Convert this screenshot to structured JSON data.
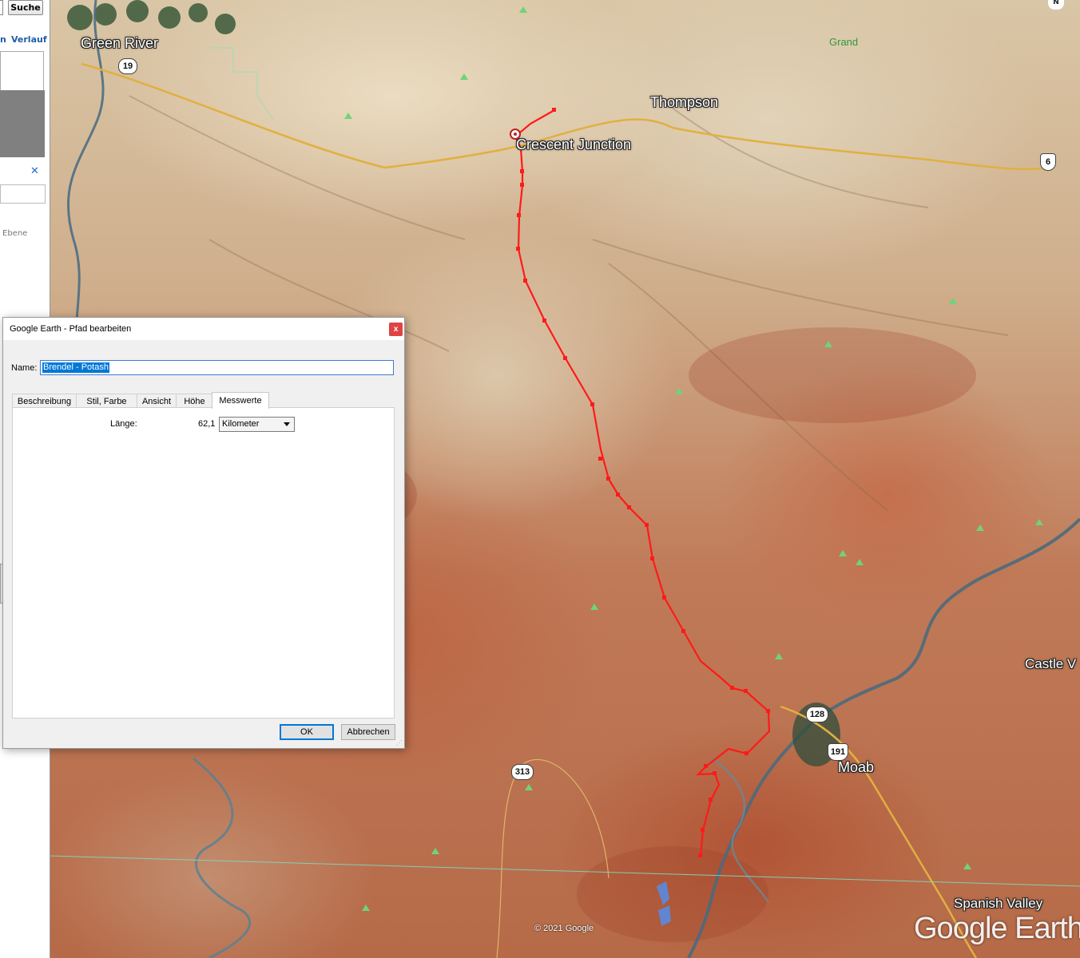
{
  "sidebar": {
    "search_button": "Suche",
    "tab_fragment": "n",
    "history_tab": "Verlauf",
    "close_glyph": "✕",
    "layer_label": "Ebene"
  },
  "map": {
    "places": [
      {
        "label": "Green River"
      },
      {
        "label": "Thompson"
      },
      {
        "label": "Crescent Junction"
      },
      {
        "label": "Grand"
      },
      {
        "label": "Moab"
      },
      {
        "label": "Castle V"
      },
      {
        "label": "Spanish Valley"
      }
    ],
    "road_shields": [
      "19",
      "6",
      "128",
      "191",
      "313"
    ],
    "north_indicator": "N",
    "copyright": "© 2021 Google",
    "logo": "Google Earth",
    "path_color": "#ff1a1a",
    "road_color": "#e0b040",
    "river_color": "#5a7a8a"
  },
  "dialog": {
    "title": "Google Earth - Pfad bearbeiten",
    "close_glyph": "x",
    "name_label": "Name:",
    "name_value": "Brendel - Potash",
    "tabs": [
      {
        "label": "Beschreibung"
      },
      {
        "label": "Stil, Farbe"
      },
      {
        "label": "Ansicht"
      },
      {
        "label": "Höhe"
      },
      {
        "label": "Messwerte"
      }
    ],
    "active_tab": "Messwerte",
    "length_label": "Länge:",
    "length_value": "62,1",
    "unit_value": "Kilometer",
    "ok_label": "OK",
    "cancel_label": "Abbrechen"
  }
}
